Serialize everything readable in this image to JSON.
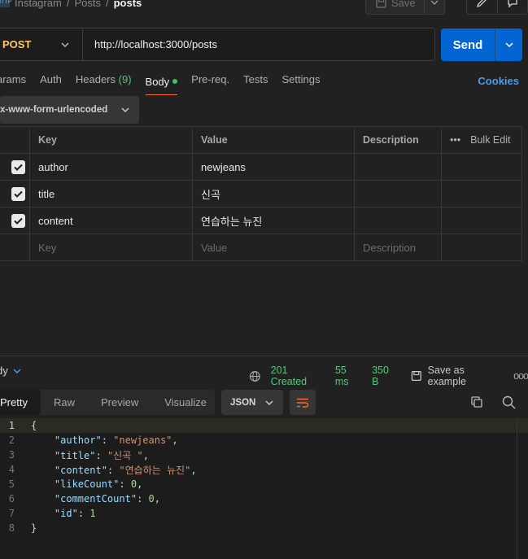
{
  "breadcrumb": {
    "badge": "HTTP",
    "items": [
      "Instagram",
      "Posts"
    ],
    "current": "posts"
  },
  "header": {
    "save_label": "Save"
  },
  "request": {
    "method": "POST",
    "url": "http://localhost:3000/posts",
    "send_label": "Send"
  },
  "tabs": {
    "params": "arams",
    "auth": "Auth",
    "headers": "Headers",
    "headers_count": "(9)",
    "body": "Body",
    "prereq": "Pre-req.",
    "tests": "Tests",
    "settings": "Settings",
    "cookies": "Cookies"
  },
  "body_type": "x-www-form-urlencoded",
  "table": {
    "headers": {
      "key": "Key",
      "value": "Value",
      "description": "Description",
      "bulk_edit": "Bulk Edit"
    },
    "rows": [
      {
        "key": "author",
        "value": "newjeans",
        "checked": true
      },
      {
        "key": "title",
        "value": "신곡",
        "checked": true
      },
      {
        "key": "content",
        "value": "연습하는 뉴진",
        "checked": true
      }
    ],
    "placeholder": {
      "key": "Key",
      "value": "Value",
      "description": "Description"
    }
  },
  "response": {
    "body_label": "dy",
    "status": "201 Created",
    "time": "55 ms",
    "size": "350 B",
    "save_example": "Save as example",
    "views": [
      "Pretty",
      "Raw",
      "Preview",
      "Visualize"
    ],
    "active_view": "Pretty",
    "format": "JSON",
    "code_lines": [
      "{",
      "    \"author\": \"newjeans\",",
      "    \"title\": \"신곡 \",",
      "    \"content\": \"연습하는 뉴진\",",
      "    \"likeCount\": 0,",
      "    \"commentCount\": 0,",
      "    \"id\": 1",
      "}"
    ]
  },
  "colors": {
    "accent": "#0265d2",
    "method": "#ffc861",
    "status_ok": "#55c87a",
    "active_tab_underline": "#ff6c37"
  }
}
